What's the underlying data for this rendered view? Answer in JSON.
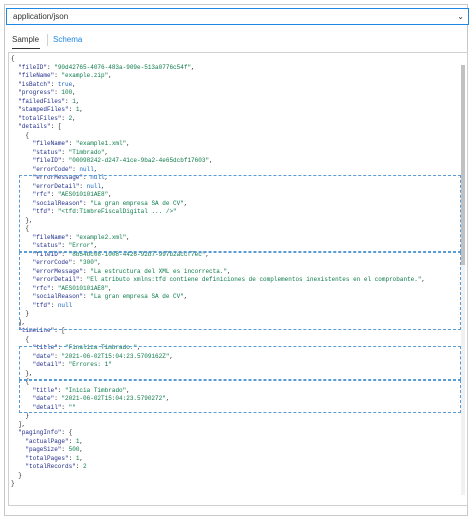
{
  "content_type": {
    "label": "application/json"
  },
  "tabs": [
    {
      "label": "Sample",
      "active": true
    },
    {
      "label": "Schema",
      "active": false
    }
  ],
  "colors": {
    "accent": "#1e88e5",
    "key": "#1f2b8a",
    "string": "#0b7a4a",
    "bool": "#1565c0",
    "highlight": "#5b9bd5"
  },
  "code_lines": [
    "{",
    "  \"fileID\": \"90d42765-4076-483a-909e-513a0776c54f\",",
    "  \"fileName\": \"example.zip\",",
    "  \"isBatch\": true,",
    "  \"progress\": 100,",
    "  \"failedFiles\": 1,",
    "  \"stampedFiles\": 1,",
    "  \"totalFiles\": 2,",
    "  \"details\": [",
    "    {",
    "      \"fileName\": \"example1.xml\",",
    "      \"status\": \"Timbrado\",",
    "      \"fileID\": \"00098242-d247-41ce-9ba2-4e65dcbf17603\",",
    "      \"errorCode\": null,",
    "      \"errorMessage\": null,",
    "      \"errorDetail\": null,",
    "      \"rfc\": \"AES010101AE8\",",
    "      \"socialReason\": \"La gran empresa SA de CV\",",
    "      \"tfd\": \"<tfd:TimbreFiscalDigital ... />\"",
    "    },",
    "    {",
    "      \"fileName\": \"example2.xml\",",
    "      \"status\": \"Error\",",
    "      \"fileID\": \"8b54bc08-1008-4426-92b7-997b2accf7ec\",",
    "      \"errorCode\": \"300\",",
    "      \"errorMessage\": \"La estructura del XML es incorrecta.\",",
    "      \"errorDetail\": \"El atributo xmlns:tfd contiene definiciones de complementos inexistentes en el comprobante.\",",
    "      \"rfc\": \"AES010101AE8\",",
    "      \"socialReason\": \"La gran empresa SA de CV\",",
    "      \"tfd\": null",
    "    }",
    "  ],",
    "  \"timeLine\": [",
    "    {",
    "      \"title\": \"Finaliza Timbrado.\",",
    "      \"date\": \"2021-06-02T15:04:23.5709162Z\",",
    "      \"detail\": \"Errores: 1\"",
    "    },",
    "    {",
    "      \"title\": \"Inicia Timbrado\",",
    "      \"date\": \"2021-06-02T15:04:23.5790272\",",
    "      \"detail\": \"\"",
    "    }",
    "  ],",
    "  \"pagingInfo\": {",
    "    \"actualPage\": 1,",
    "    \"pageSize\": 500,",
    "    \"totalPages\": 1,",
    "    \"totalRecords\": 2",
    "  }",
    "}"
  ]
}
